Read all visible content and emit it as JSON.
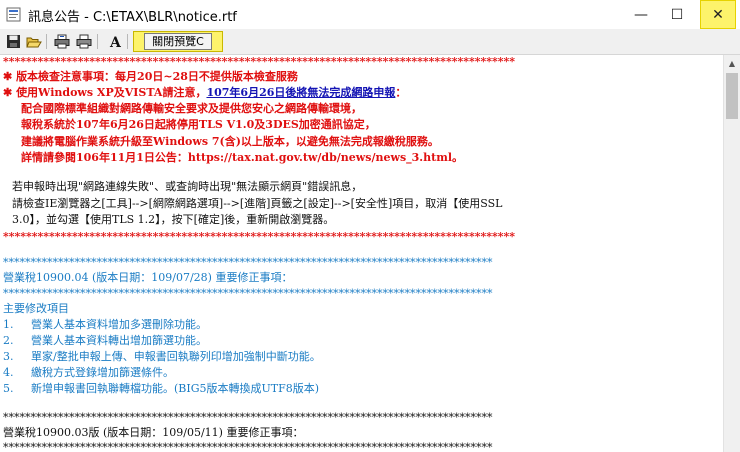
{
  "window": {
    "title": "訊息公告 - C:\\ETAX\\BLR\\notice.rtf",
    "minimize": "—",
    "maximize": "☐",
    "close": "✕"
  },
  "toolbar": {
    "close_preview_label": "關閉預覽C"
  },
  "notice": {
    "stars_red": "*****************************************************************************************",
    "stars_blue": "*****************************************************************************************",
    "stars_black": "*****************************************************************************************",
    "version_line": "版本檢查注意事項：每月20日~28日不提供版本檢查服務",
    "xp_line_prefix": "使用Windows XP及VISTA請注意，",
    "xp_link": "107年6月26日後將無法完成網路申報",
    "xp_line_suffix": "：",
    "red_lines": [
      "配合國際標準組織對網路傳輸安全要求及提供您安心之網路傳輸環境，",
      "報稅系統於107年6月26日起將停用TLS V1.0及3DES加密通訊協定，",
      "建議將電腦作業系統升級至Windows 7(含)以上版本，以避免無法完成報繳稅服務。",
      "詳情請參閱106年11月1日公告：https://tax.nat.gov.tw/db/news/news_3.html。"
    ],
    "black_lines": [
      "若申報時出現\"網路連線失敗\"、或查詢時出現\"無法顯示網頁\"錯誤訊息，",
      "請檢查IE瀏覽器之[工具]-->[網際網路選項]-->[進階]頁籤之[設定]-->[安全性]項目，取消【使用SSL",
      "3.0】，並勾選【使用TLS 1.2】，按下[確定]後，重新開啟瀏覽器。"
    ],
    "section1_header": "營業稅10900.04 (版本日期：109/07/28) 重要修正事項：",
    "section1_subtitle": "主要修改項目",
    "section1_items": [
      {
        "num": "1.",
        "text": "營業人基本資料增加多選刪除功能。"
      },
      {
        "num": "2.",
        "text": "營業人基本資料轉出增加篩選功能。"
      },
      {
        "num": "3.",
        "text": "單家/整批申報上傳、申報書回執聯列印增加強制中斷功能。"
      },
      {
        "num": "4.",
        "text": "繳稅方式登錄增加篩選條件。"
      },
      {
        "num": "5.",
        "text": "新增申報書回執聯轉檔功能。(BIG5版本轉換成UTF8版本)"
      }
    ],
    "section2_header": "營業稅10900.03版 (版本日期：109/05/11) 重要修正事項："
  }
}
